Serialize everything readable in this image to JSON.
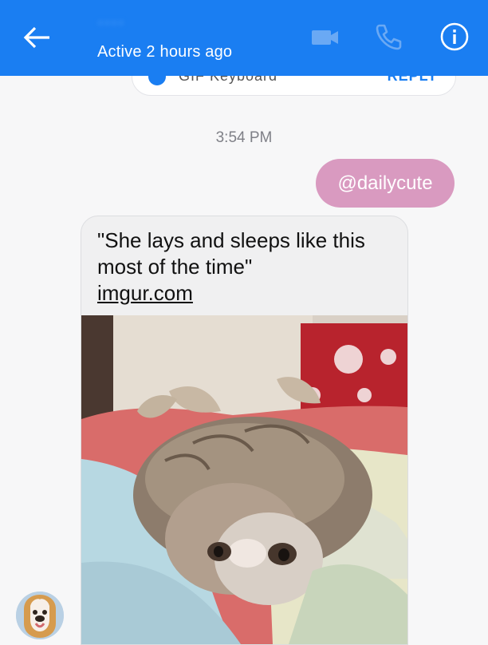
{
  "header": {
    "title": "••••",
    "status": "Active 2 hours ago",
    "back_icon": "arrow-left-icon",
    "video_icon": "video-camera-icon",
    "phone_icon": "phone-icon",
    "info_icon": "info-icon",
    "color": "#1a7ef2"
  },
  "suggestion": {
    "left_text": "GIF Keyboard",
    "right_text": "REPLY"
  },
  "messages": {
    "timestamp": "3:54 PM",
    "sent": {
      "text": "@dailycute",
      "color": "#d99ac0"
    },
    "received": {
      "quote": "\"She lays and sleeps like this most of the time\"",
      "link": "imgur.com"
    }
  }
}
